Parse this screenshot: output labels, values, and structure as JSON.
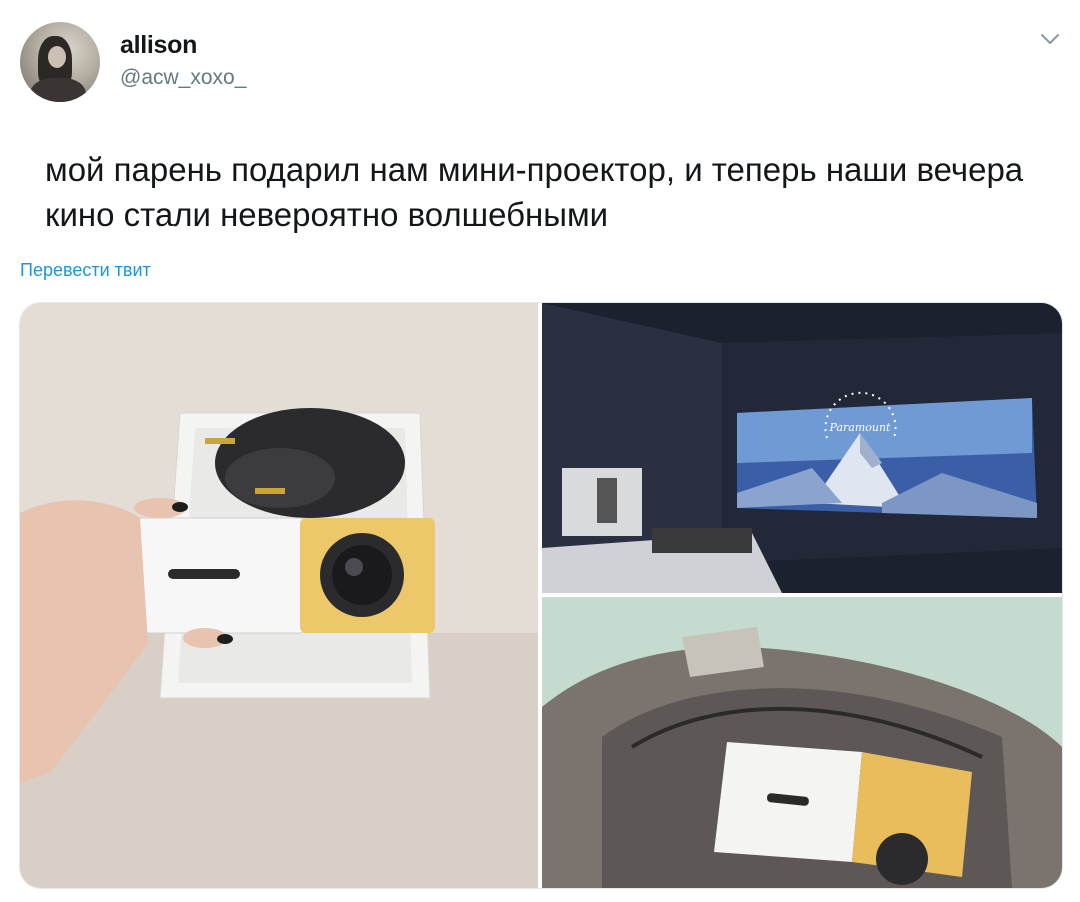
{
  "user": {
    "display_name": "allison",
    "handle": "@acw_xoxo_"
  },
  "tweet": {
    "text": "мой парень подарил нам мини-проектор, и теперь наши вечера кино стали невероятно волшебными",
    "translate_link": "Перевести твит"
  },
  "media": {
    "photo_count": 3,
    "photos": [
      {
        "name": "projector-in-hand-photo"
      },
      {
        "name": "projected-movie-photo",
        "screen_text": "Paramount"
      },
      {
        "name": "projector-in-bag-photo"
      }
    ]
  },
  "icons": {
    "menu": "chevron-down-icon"
  },
  "colors": {
    "text_primary": "#14171a",
    "text_secondary": "#657786",
    "link": "#1b95e0",
    "border": "#e1e8ed"
  }
}
